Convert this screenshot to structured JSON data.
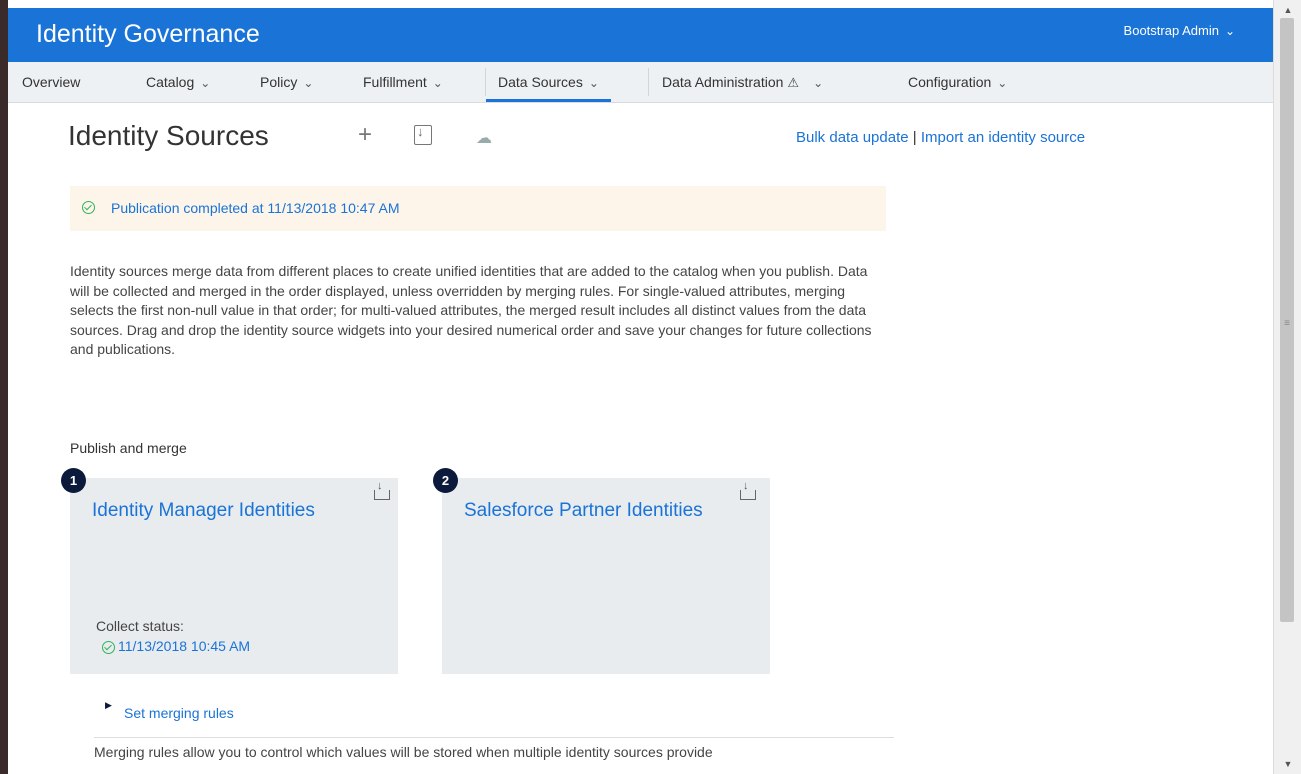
{
  "header": {
    "app_title": "Identity Governance",
    "user": "Bootstrap Admin"
  },
  "nav": {
    "items": [
      {
        "label": "Overview"
      },
      {
        "label": "Catalog"
      },
      {
        "label": "Policy"
      },
      {
        "label": "Fulfillment"
      },
      {
        "label": "Data Sources"
      },
      {
        "label": "Data Administration"
      },
      {
        "label": "Configuration"
      }
    ],
    "active": "Data Sources"
  },
  "page": {
    "title": "Identity Sources",
    "links": {
      "bulk": "Bulk data update",
      "separator": "|",
      "import": "Import an identity source"
    }
  },
  "banner": {
    "text": "Publication completed at 11/13/2018 10:47 AM"
  },
  "description": "Identity sources merge data from different places to create unified identities that are added to the catalog when you publish. Data will be collected and merged in the order displayed, unless overridden by merging rules. For single-valued attributes, merging selects the first non-null value in that order; for multi-valued attributes, the merged result includes all distinct values from the data sources. Drag and drop the identity source widgets into your desired numerical order and save your changes for future collections and publications.",
  "publish": {
    "section_label": "Publish and merge",
    "cards": [
      {
        "number": "1",
        "title": "Identity Manager Identities",
        "status_label": "Collect status:",
        "status_value": "11/13/2018 10:45 AM"
      },
      {
        "number": "2",
        "title": "Salesforce Partner Identities"
      }
    ]
  },
  "merging": {
    "link": "Set merging rules",
    "description": "Merging rules allow you to control which values will be stored when multiple identity sources provide"
  },
  "colors": {
    "header_bg": "#1a73d6",
    "link": "#1a73d6",
    "banner_bg": "#fdf5ea",
    "success": "#2fb35a",
    "card_bg": "#e8ecef",
    "badge_bg": "#0b1a3a"
  }
}
